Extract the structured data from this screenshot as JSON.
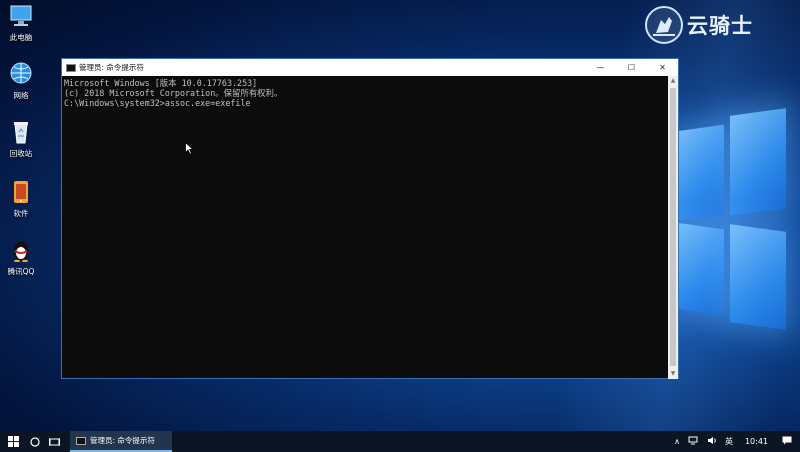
{
  "desktop": {
    "icons": [
      {
        "label": "此电脑",
        "icon": "computer-icon"
      },
      {
        "label": "网络",
        "icon": "network-icon"
      },
      {
        "label": "回收站",
        "icon": "recycle-bin-icon"
      },
      {
        "label": "软件",
        "icon": "software-icon"
      },
      {
        "label": "腾讯QQ",
        "icon": "qq-penguin-icon"
      }
    ],
    "brand": "云骑士"
  },
  "console": {
    "title": "管理员: 命令提示符",
    "lines": [
      "Microsoft Windows [版本 10.0.17763.253]",
      "(c) 2018 Microsoft Corporation。保留所有权利。",
      "",
      "C:\\Windows\\system32>assoc.exe=exefile"
    ],
    "controls": {
      "minimize": "—",
      "maximize": "☐",
      "close": "✕"
    }
  },
  "taskbar": {
    "task_label": "管理员: 命令提示符",
    "tray": {
      "chevron": "∧",
      "lang": "英",
      "time": "10:41"
    }
  },
  "colors": {
    "console_bg": "#0c0c0c",
    "console_text": "#c0c0c0",
    "taskbar_bg": "#0b1524",
    "accent": "#76b9ed"
  }
}
